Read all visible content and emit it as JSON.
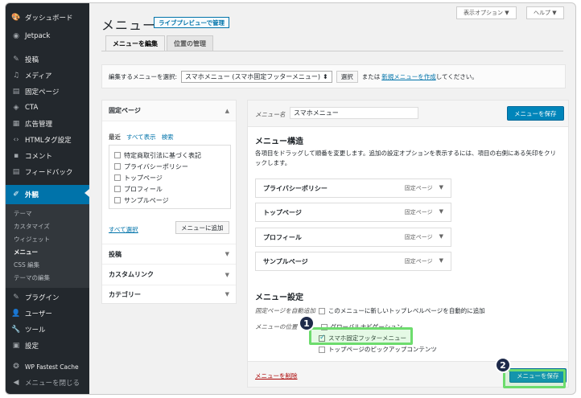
{
  "sidebar": {
    "items": [
      {
        "label": "ダッシュボード",
        "icon": "🎨"
      },
      {
        "label": "Jetpack",
        "icon": "◉"
      },
      {
        "label": "投稿",
        "icon": "✎"
      },
      {
        "label": "メディア",
        "icon": "♫"
      },
      {
        "label": "固定ページ",
        "icon": "▤"
      },
      {
        "label": "CTA",
        "icon": "◈"
      },
      {
        "label": "広告管理",
        "icon": "▦"
      },
      {
        "label": "HTMLタグ設定",
        "icon": "‹›"
      },
      {
        "label": "コメント",
        "icon": "▪"
      },
      {
        "label": "フィードバック",
        "icon": "▤"
      },
      {
        "label": "外観",
        "icon": "✐"
      }
    ],
    "submenu": [
      "テーマ",
      "カスタマイズ",
      "ウィジェット",
      "メニュー",
      "CSS 編集",
      "テーマの編集"
    ],
    "lower": [
      {
        "label": "プラグイン",
        "icon": "✎"
      },
      {
        "label": "ユーザー",
        "icon": "👤"
      },
      {
        "label": "ツール",
        "icon": "🔧"
      },
      {
        "label": "設定",
        "icon": "▣"
      },
      {
        "label": "WP Fastest Cache",
        "icon": "❂"
      },
      {
        "label": "メニューを閉じる",
        "icon": "◀"
      }
    ]
  },
  "top": {
    "display_options": "表示オプション ▼",
    "help": "ヘルプ ▼"
  },
  "page": {
    "title": "メニュー",
    "live_preview": "ライブプレビューで管理"
  },
  "tabs": [
    "メニューを編集",
    "位置の管理"
  ],
  "select_bar": {
    "label": "編集するメニューを選択:",
    "selected": "スマホメニュー (スマホ固定フッターメニュー)",
    "arrow": "⬍",
    "select_btn": "選択",
    "or_text": "または",
    "create_link": "新規メニューを作成",
    "suffix": "してください。"
  },
  "left": {
    "pages_header": "固定ページ",
    "subtabs": [
      "最近",
      "すべて表示",
      "検索"
    ],
    "pages": [
      "特定商取引法に基づく表記",
      "プライバシーポリシー",
      "トップページ",
      "プロフィール",
      "サンプルページ"
    ],
    "select_all": "すべて選択",
    "add_btn": "メニューに追加",
    "sections": [
      "投稿",
      "カスタムリンク",
      "カテゴリー"
    ]
  },
  "right": {
    "name_label": "メニュー名",
    "name_value": "スマホメニュー",
    "save_btn": "メニューを保存",
    "structure_title": "メニュー構造",
    "structure_desc": "各項目をドラッグして順番を変更します。追加の設定オプションを表示するには、項目の右側にある矢印をクリックします。",
    "items": [
      {
        "label": "プライバシーポリシー",
        "type": "固定ページ"
      },
      {
        "label": "トップページ",
        "type": "固定ページ"
      },
      {
        "label": "プロフィール",
        "type": "固定ページ"
      },
      {
        "label": "サンプルページ",
        "type": "固定ページ"
      }
    ],
    "settings_title": "メニュー設定",
    "auto_add_label": "固定ページを自動追加",
    "auto_add_text": "このメニューに新しいトップレベルページを自動的に追加",
    "location_label": "メニューの位置",
    "locations": [
      "グローバルナビゲーション",
      "スマホ固定フッターメニュー",
      "トップページのピックアップコンテンツ"
    ],
    "delete": "メニューを削除"
  },
  "markers": [
    "1",
    "2"
  ],
  "colors": {
    "sidebar": "#23282d",
    "accent": "#0073aa",
    "primary_btn": "#0085ba",
    "highlight": "#6ddc6d"
  }
}
